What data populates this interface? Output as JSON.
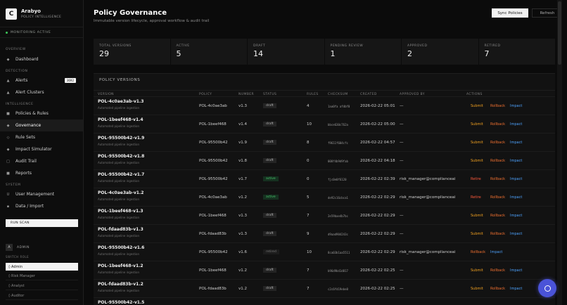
{
  "brand": {
    "logo": "C",
    "name": "Arabyo",
    "sub": "POLICY INTELLIGENCE"
  },
  "monitor": "MONITORING ACTIVE",
  "sidebar": {
    "overview_label": "OVERVIEW",
    "detection_label": "DETECTION",
    "intelligence_label": "INTELLIGENCE",
    "system_label": "SYSTEM",
    "items": {
      "dashboard": "Dashboard",
      "alerts": "Alerts",
      "alerts_badge": "3692",
      "alert_clusters": "Alert Clusters",
      "policies": "Policies & Rules",
      "governance": "Governance",
      "rule_sets": "Rule Sets",
      "impact_sim": "Impact Simulator",
      "audit": "Audit Trail",
      "reports": "Reports",
      "users": "User Management",
      "data": "Data / Import"
    },
    "run_scan": "RUN SCAN",
    "admin_avatar": "A",
    "admin": "ADMIN",
    "switch_role": "SWITCH ROLE",
    "roles": [
      "◊ Admin",
      "◊ Risk Manager",
      "◊ Analyst",
      "◊ Auditor"
    ]
  },
  "header": {
    "title": "Policy Governance",
    "subtitle": "Immutable version lifecycle, approval workflow & audit trail",
    "sync": "Sync Policies",
    "refresh": "Refresh"
  },
  "stats": [
    {
      "label": "TOTAL VERSIONS",
      "value": "29"
    },
    {
      "label": "ACTIVE",
      "value": "5"
    },
    {
      "label": "DRAFT",
      "value": "14"
    },
    {
      "label": "PENDING REVIEW",
      "value": "1"
    },
    {
      "label": "APPROVED",
      "value": "2"
    },
    {
      "label": "RETIRED",
      "value": "7"
    }
  ],
  "table": {
    "title": "POLICY VERSIONS",
    "columns": [
      "VERSION",
      "POLICY",
      "NUMBER",
      "STATUS",
      "RULES",
      "CHECKSUM",
      "CREATED",
      "APPROVED BY",
      "ACTIONS"
    ],
    "rows": [
      {
        "version": "POL-4c0ae3ab-v1.3",
        "sub": "Automated pipeline ingestion",
        "policy": "POL-4c0ae3ab",
        "number": "v1.3",
        "status": "draft",
        "rules": "4",
        "checksum": "1aa0fa afdbf0",
        "created": "2026-02-22 05:01",
        "approved": "—",
        "actions": [
          "Submit",
          "Rollback",
          "Impact"
        ]
      },
      {
        "version": "POL-1beef468-v1.4",
        "sub": "Automated pipeline ingestion",
        "policy": "POL-1beef468",
        "number": "v1.4",
        "status": "draft",
        "rules": "10",
        "checksum": "bbce630c762a",
        "created": "2026-02-22 05:00",
        "approved": "—",
        "actions": [
          "Submit",
          "Rollback",
          "Impact"
        ]
      },
      {
        "version": "POL-95500b42-v1.9",
        "sub": "Automated pipeline ingestion",
        "policy": "POL-95500b42",
        "number": "v1.9",
        "status": "draft",
        "rules": "8",
        "checksum": "f9611f604cfc",
        "created": "2026-02-22 04:57",
        "approved": "—",
        "actions": [
          "Submit",
          "Rollback",
          "Impact"
        ]
      },
      {
        "version": "POL-95500b42-v1.8",
        "sub": "Automated pipeline ingestion",
        "policy": "POL-95500b42",
        "number": "v1.8",
        "status": "draft",
        "rules": "0",
        "checksum": "008f4b9d9fab",
        "created": "2026-02-22 04:18",
        "approved": "—",
        "actions": [
          "Submit",
          "Rollback",
          "Impact"
        ]
      },
      {
        "version": "POL-95500b42-v1.7",
        "sub": "Automated pipeline ingestion",
        "policy": "POL-95500b42",
        "number": "v1.7",
        "status": "active",
        "rules": "0",
        "checksum": "fjc0e0f6120",
        "created": "2026-02-22 02:39",
        "approved": "risk_manager@complianceai",
        "actions": [
          "Retire",
          "Rollback",
          "Impact"
        ]
      },
      {
        "version": "POL-4c0ae3ab-v1.2",
        "sub": "Automated pipeline ingestion",
        "policy": "POL-4c0ae3ab",
        "number": "v1.2",
        "status": "active",
        "rules": "5",
        "checksum": "de92c16cbca1",
        "created": "2026-02-22 02:29",
        "approved": "risk_manager@complianceai",
        "actions": [
          "Retire",
          "Rollback",
          "Impact"
        ]
      },
      {
        "version": "POL-1beef468-v1.3",
        "sub": "Automated pipeline ingestion",
        "policy": "POL-1beef468",
        "number": "v1.3",
        "status": "draft",
        "rules": "7",
        "checksum": "2e59bae4b7bc",
        "created": "2026-02-22 02:29",
        "approved": "—",
        "actions": [
          "Submit",
          "Rollback",
          "Impact"
        ]
      },
      {
        "version": "POL-fdaad83b-v1.3",
        "sub": "Automated pipeline ingestion",
        "policy": "POL-fdaad83b",
        "number": "v1.3",
        "status": "draft",
        "rules": "9",
        "checksum": "d9aad904243c",
        "created": "2026-02-22 02:29",
        "approved": "—",
        "actions": [
          "Submit",
          "Rollback",
          "Impact"
        ]
      },
      {
        "version": "POL-95500b42-v1.6",
        "sub": "Automated pipeline ingestion",
        "policy": "POL-95500b42",
        "number": "v1.6",
        "status": "retired",
        "rules": "10",
        "checksum": "8ca03b1aa5511",
        "created": "2026-02-22 02:29",
        "approved": "risk_manager@complianceai",
        "actions": [
          "Rollback",
          "Impact"
        ]
      },
      {
        "version": "POL-1beef468-v1.2",
        "sub": "Automated pipeline ingestion",
        "policy": "POL-1beef468",
        "number": "v1.2",
        "status": "draft",
        "rules": "7",
        "checksum": "b96d9bd1d817",
        "created": "2026-02-22 02:25",
        "approved": "—",
        "actions": [
          "Submit",
          "Rollback",
          "Impact"
        ]
      },
      {
        "version": "POL-fdaad83b-v1.2",
        "sub": "Automated pipeline ingestion",
        "policy": "POL-fdaad83b",
        "number": "v1.2",
        "status": "draft",
        "rules": "7",
        "checksum": "c2c6fd19ebe8",
        "created": "2026-02-22 02:25",
        "approved": "—",
        "actions": [
          "Submit",
          "Rollback",
          "Impact"
        ]
      },
      {
        "version": "POL-95500b42-v1.5",
        "sub": "",
        "policy": "",
        "number": "",
        "status": "",
        "rules": "",
        "checksum": "",
        "created": "",
        "approved": "",
        "actions": []
      }
    ]
  },
  "colors": {
    "submit": "#f0a020",
    "rollback": "#f07030",
    "impact": "#4ea3ff",
    "retire": "#ff5a3c",
    "active_status": "#47c46b",
    "fab": "#4a53d8"
  }
}
